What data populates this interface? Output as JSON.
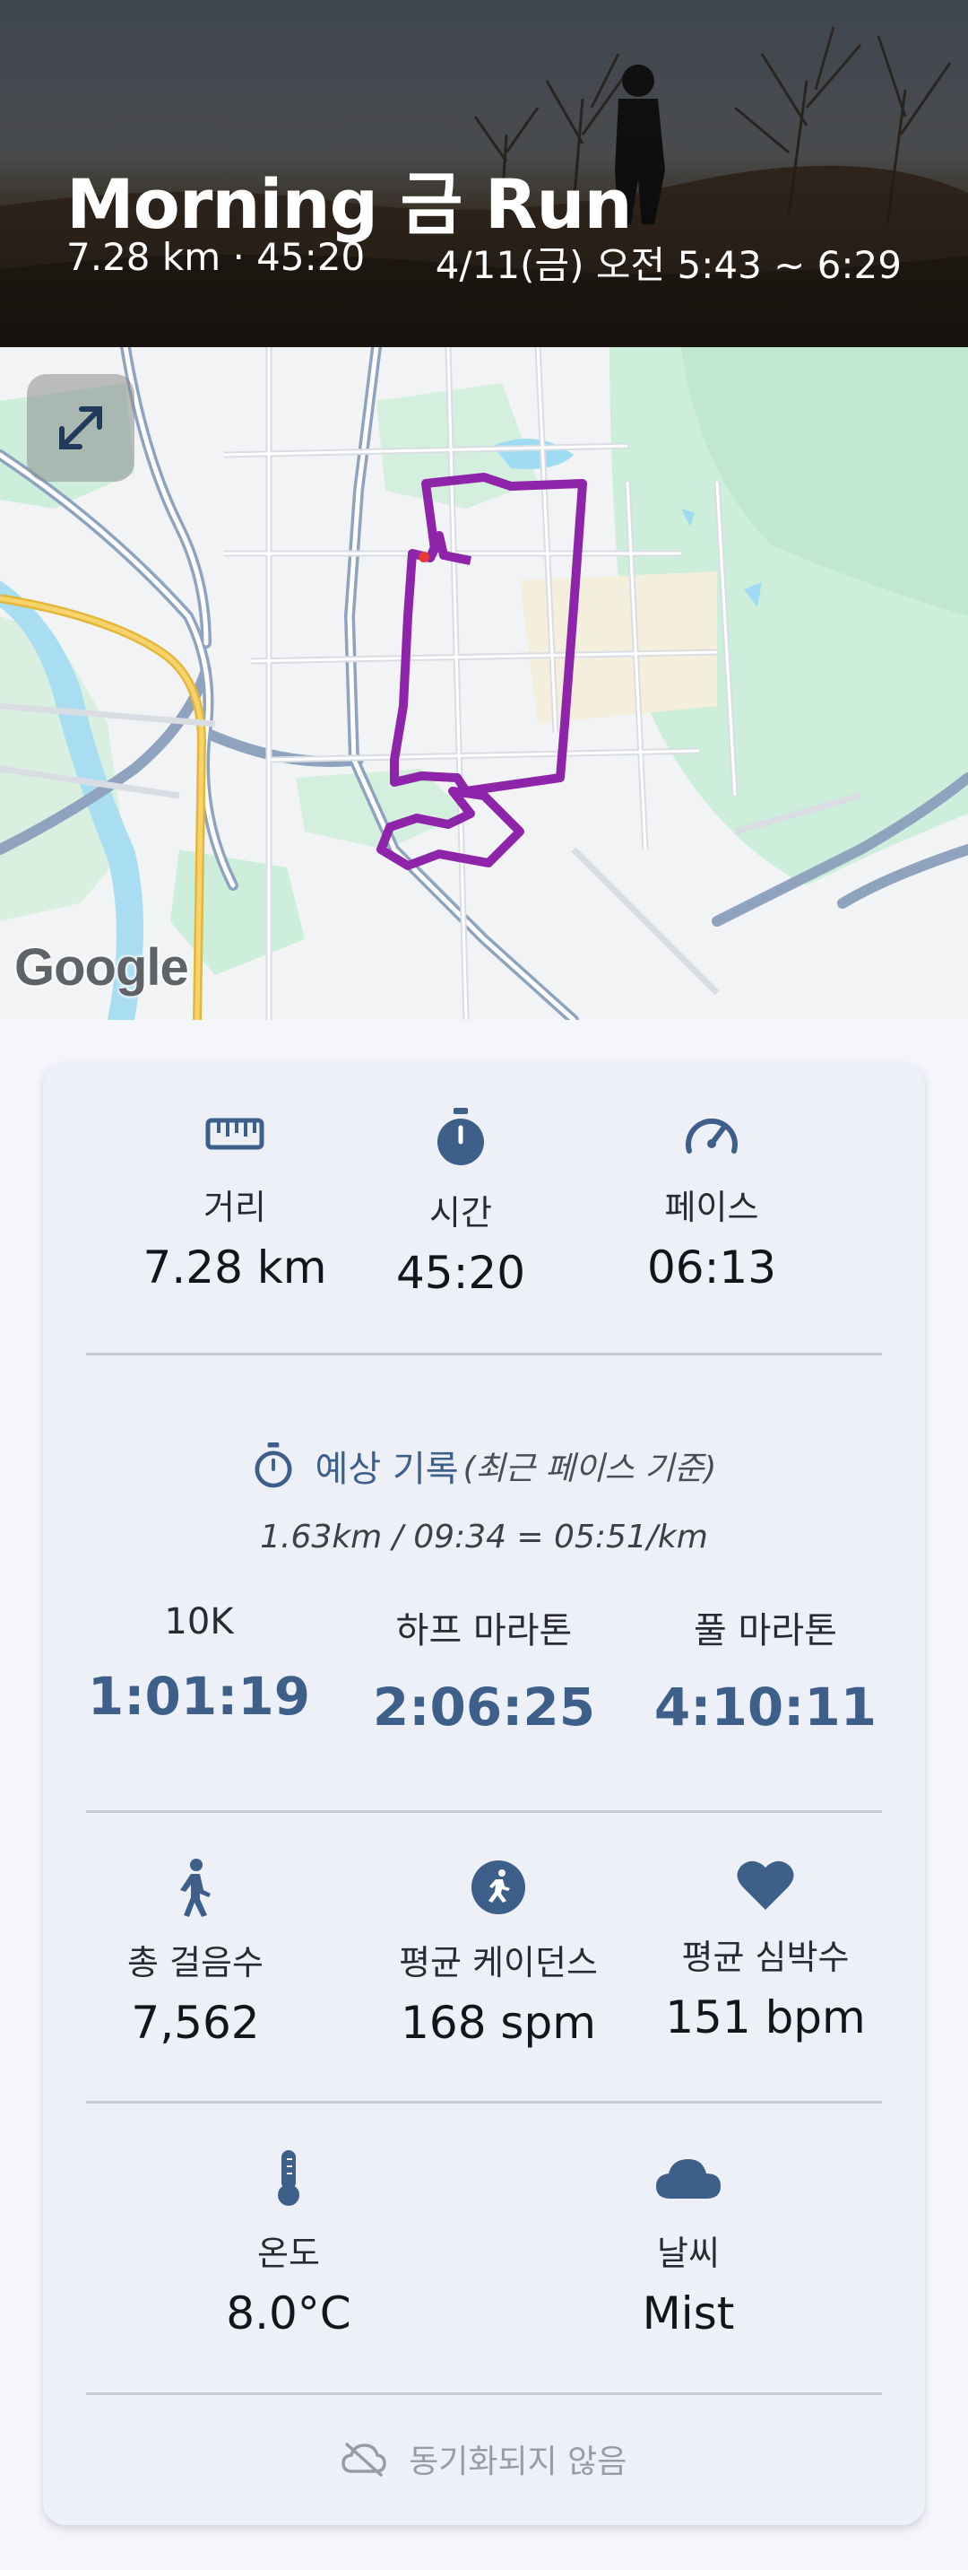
{
  "header": {
    "title": "Morning 금 Run",
    "summary": "7.28 km · 45:20",
    "datetime": "4/11(금) 오전 5:43 ~ 6:29"
  },
  "map": {
    "logo": "Google",
    "expand_icon": "expand-icon",
    "route_color": "#8e24aa"
  },
  "stats": {
    "distance": {
      "label": "거리",
      "value": "7.28 km",
      "icon": "ruler-icon"
    },
    "time": {
      "label": "시간",
      "value": "45:20",
      "icon": "stopwatch-icon"
    },
    "pace": {
      "label": "페이스",
      "value": "06:13",
      "icon": "speedometer-icon"
    }
  },
  "prediction": {
    "title": "예상 기록",
    "subtitle": "(최근 페이스 기준)",
    "formula": "1.63km / 09:34 = 05:51/km",
    "items": [
      {
        "label": "10K",
        "value": "1:01:19"
      },
      {
        "label": "하프 마라톤",
        "value": "2:06:25"
      },
      {
        "label": "풀 마라톤",
        "value": "4:10:11"
      }
    ]
  },
  "activity": {
    "steps": {
      "label": "총 걸음수",
      "value": "7,562",
      "icon": "walking-icon"
    },
    "cadence": {
      "label": "평균 케이던스",
      "value": "168 spm",
      "icon": "running-icon"
    },
    "heart_rate": {
      "label": "평균 심박수",
      "value": "151 bpm",
      "icon": "heart-icon"
    }
  },
  "weather": {
    "temperature": {
      "label": "온도",
      "value": "8.0°C",
      "icon": "thermometer-icon"
    },
    "condition": {
      "label": "날씨",
      "value": "Mist",
      "icon": "cloud-icon"
    }
  },
  "sync_status": "동기화되지 않음",
  "colors": {
    "accent": "#3d5f8a",
    "card_bg": "#eef0f8"
  }
}
